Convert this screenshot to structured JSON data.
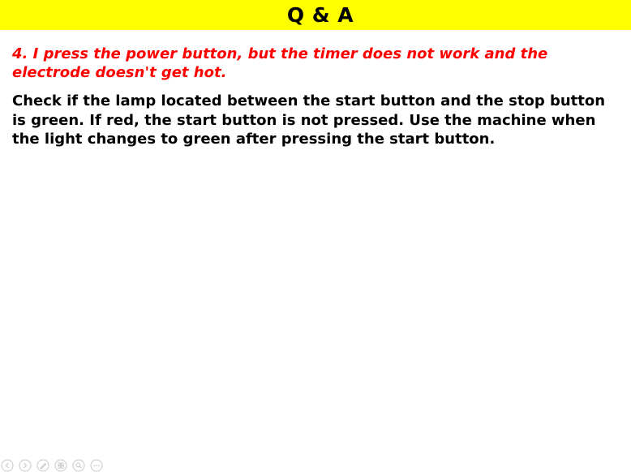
{
  "slide": {
    "title": "Q & A",
    "question": "4. I press the power button, but the timer does not work and the electrode doesn't get hot.",
    "answer": "Check if the lamp located between the start button and the stop button is green. If red, the start button is not pressed. Use the machine when the light changes to green after pressing the start button."
  },
  "colors": {
    "title_bar": "#ffff00",
    "question_text": "#ff0000",
    "answer_text": "#000000",
    "nav_icon": "#c8c8c8"
  },
  "nav_controls": [
    {
      "icon": "previous-slide-icon"
    },
    {
      "icon": "next-slide-icon"
    },
    {
      "icon": "pen-icon"
    },
    {
      "icon": "slide-sorter-icon"
    },
    {
      "icon": "zoom-icon"
    },
    {
      "icon": "more-options-icon"
    }
  ]
}
